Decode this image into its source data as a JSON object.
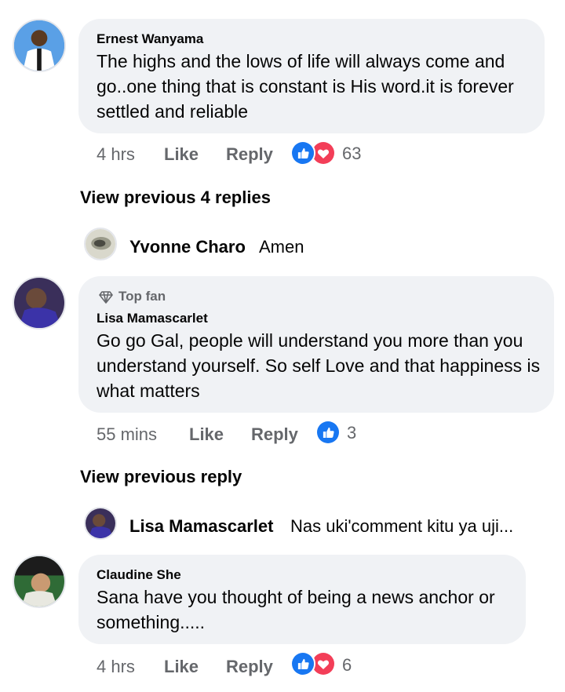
{
  "colors": {
    "bubble": "#f0f2f5",
    "secondary_text": "#65676b",
    "like_blue": "#1877f2",
    "love_red": "#f33e58"
  },
  "comments": [
    {
      "author": "Ernest Wanyama",
      "text": "The highs and the lows of life will always come and go..one thing that is constant is His word.it is forever settled and reliable",
      "time": "4 hrs",
      "like_label": "Like",
      "reply_label": "Reply",
      "reactions": [
        "like-icon",
        "love-icon"
      ],
      "reaction_count": "63",
      "view_previous": "View previous 4 replies",
      "latest_reply": {
        "author": "Yvonne Charo",
        "text": "Amen"
      }
    },
    {
      "badge": "Top fan",
      "author": "Lisa Mamascarlet",
      "text": "Go go Gal, people will understand you more than you understand yourself. So self Love and that happiness is what matters",
      "time": "55 mins",
      "like_label": "Like",
      "reply_label": "Reply",
      "reactions": [
        "like-icon"
      ],
      "reaction_count": "3",
      "view_previous": "View previous reply",
      "latest_reply": {
        "author": "Lisa Mamascarlet",
        "text": "Nas uki'comment kitu ya uji..."
      }
    },
    {
      "author": "Claudine She",
      "text": "Sana have you thought of being a news anchor or something.....",
      "time": "4 hrs",
      "like_label": "Like",
      "reply_label": "Reply",
      "reactions": [
        "like-icon",
        "love-icon"
      ],
      "reaction_count": "6"
    }
  ]
}
